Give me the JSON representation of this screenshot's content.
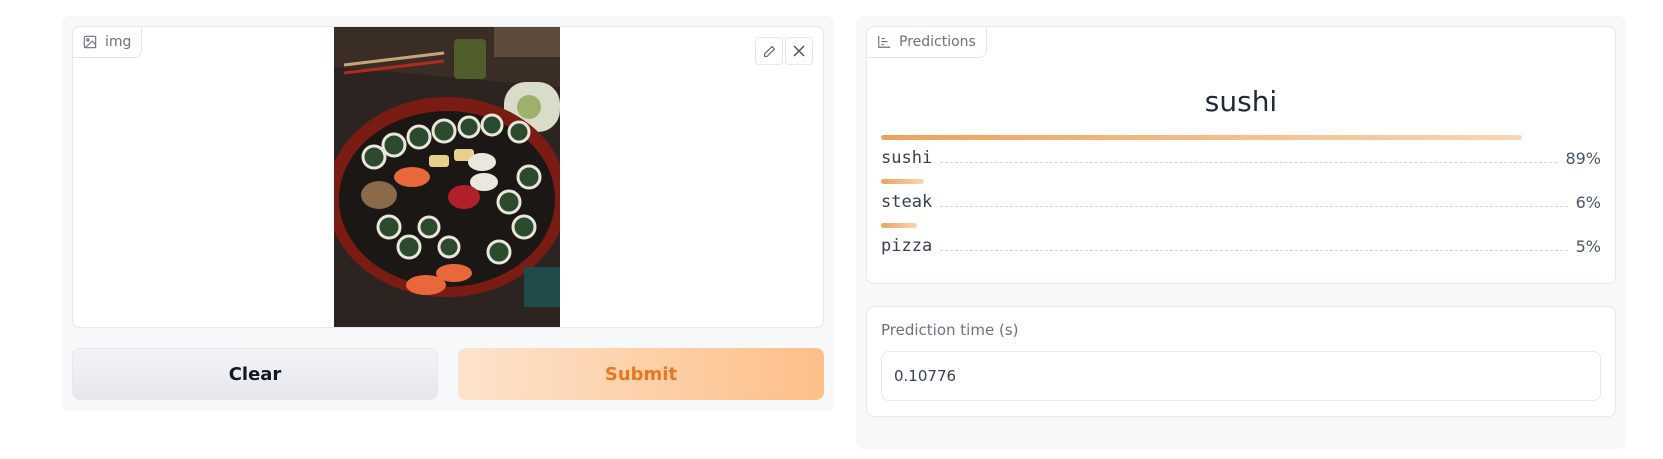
{
  "input": {
    "tag_label": "img",
    "clear_label": "Clear",
    "submit_label": "Submit"
  },
  "output": {
    "tag_label": "Predictions",
    "top_label": "sushi",
    "confidences": [
      {
        "label": "sushi",
        "percent": "89%",
        "value": 0.89
      },
      {
        "label": "steak",
        "percent": "6%",
        "value": 0.06
      },
      {
        "label": "pizza",
        "percent": "5%",
        "value": 0.05
      }
    ],
    "time_label": "Prediction time (s)",
    "time_value": "0.10776"
  },
  "colors": {
    "accent": "#e87722",
    "bar_start": "#eea25a",
    "bar_end": "#f8d6b3"
  }
}
